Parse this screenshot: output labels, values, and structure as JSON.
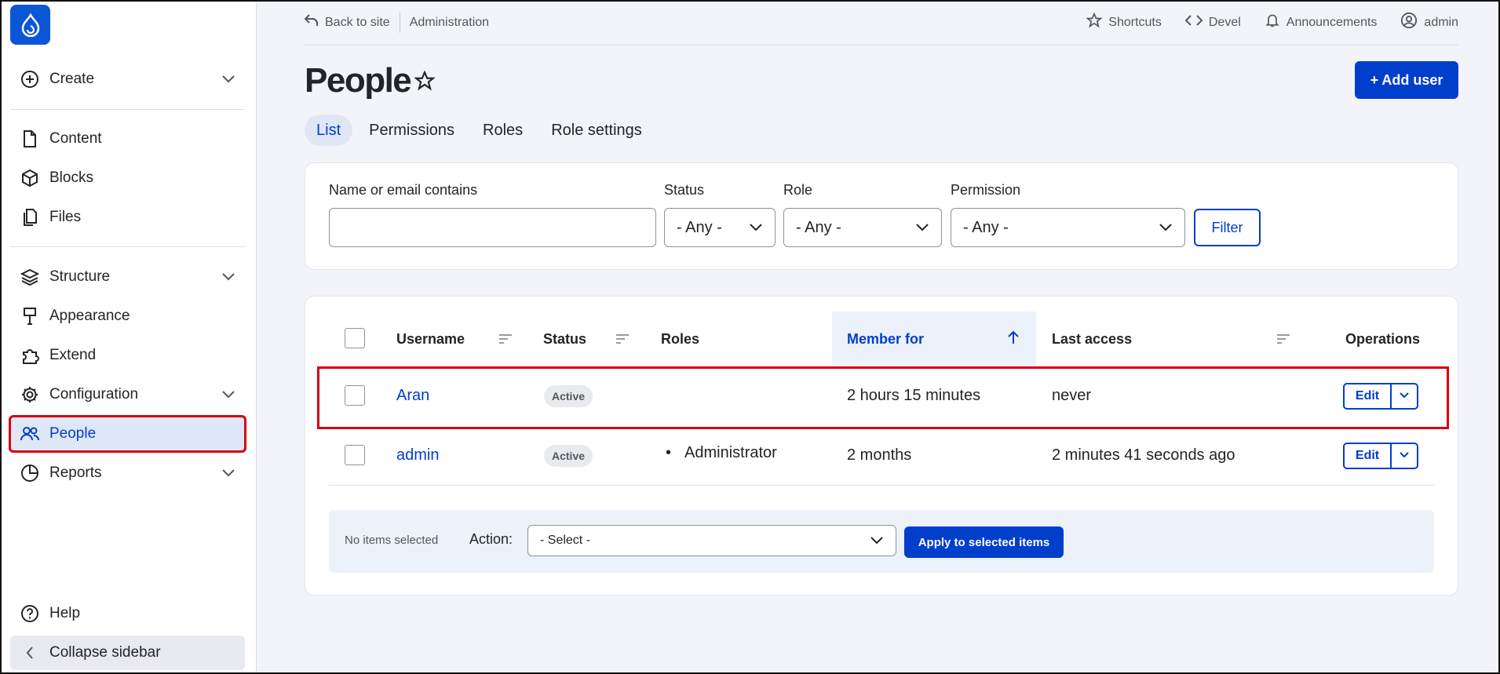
{
  "sidebar": {
    "items": [
      {
        "label": "Create"
      },
      {
        "label": "Content"
      },
      {
        "label": "Blocks"
      },
      {
        "label": "Files"
      },
      {
        "label": "Structure"
      },
      {
        "label": "Appearance"
      },
      {
        "label": "Extend"
      },
      {
        "label": "Configuration"
      },
      {
        "label": "People"
      },
      {
        "label": "Reports"
      }
    ],
    "help": "Help",
    "collapse": "Collapse sidebar"
  },
  "topbar": {
    "back": "Back to site",
    "admin_crumb": "Administration",
    "shortcuts": "Shortcuts",
    "devel": "Devel",
    "announcements": "Announcements",
    "user": "admin"
  },
  "page": {
    "title": "People",
    "add_user": "+ Add user"
  },
  "tabs": [
    "List",
    "Permissions",
    "Roles",
    "Role settings"
  ],
  "filters": {
    "name_label": "Name or email contains",
    "name_value": "",
    "status_label": "Status",
    "status_value": "- Any -",
    "role_label": "Role",
    "role_value": "- Any -",
    "permission_label": "Permission",
    "permission_value": "- Any -",
    "button": "Filter"
  },
  "table": {
    "headers": [
      "Username",
      "Status",
      "Roles",
      "Member for",
      "Last access",
      "Operations"
    ],
    "rows": [
      {
        "username": "Aran",
        "status": "Active",
        "roles": "",
        "member_for": "2 hours 15 minutes",
        "last_access": "never",
        "edit": "Edit"
      },
      {
        "username": "admin",
        "status": "Active",
        "roles": "Administrator",
        "member_for": "2 months",
        "last_access": "2 minutes 41 seconds ago",
        "edit": "Edit"
      }
    ]
  },
  "bulk": {
    "selected": "No items selected",
    "action_label": "Action:",
    "action_value": "- Select -",
    "apply": "Apply to selected items"
  },
  "colors": {
    "accent": "#003ecc",
    "highlight": "#d6000f",
    "sidebar_active": "#dfe7f7"
  }
}
